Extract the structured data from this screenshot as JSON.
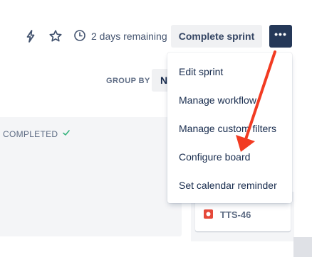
{
  "toolbar": {
    "icons": [
      "lightning-icon",
      "star-icon",
      "clock-icon"
    ],
    "days_remaining": "2 days remaining",
    "complete_sprint_label": "Complete sprint",
    "more_icon": "more-horizontal-icon"
  },
  "group_by": {
    "label": "GROUP BY",
    "value": "N"
  },
  "columns": {
    "completed_label": "COMPLETED",
    "completed_icon": "check-icon"
  },
  "issue": {
    "key": "TTS-46",
    "type_icon": "bug-icon"
  },
  "menu": {
    "items": [
      {
        "label": "Edit sprint"
      },
      {
        "label": "Manage workflow"
      },
      {
        "label": "Manage custom filters"
      },
      {
        "label": "Configure board"
      },
      {
        "label": "Set calendar reminder"
      }
    ]
  },
  "colors": {
    "accent": "#253858",
    "annotation_arrow": "#f23b22",
    "done_check": "#36b37e",
    "bug": "#e5493a"
  }
}
